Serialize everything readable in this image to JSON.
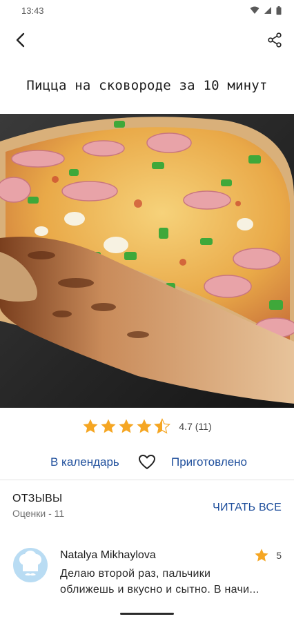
{
  "status_bar": {
    "time": "13:43"
  },
  "recipe": {
    "title": "Пицца на сковороде за 10 минут",
    "rating": {
      "stars": 4.5,
      "max": 5,
      "label": "4.7 (11)"
    }
  },
  "actions": {
    "calendar_label": "В календарь",
    "cooked_label": "Приготовлено"
  },
  "reviews": {
    "title": "ОТЗЫВЫ",
    "count_label": "Оценки - 11",
    "read_all_label": "ЧИТАТЬ ВСЕ",
    "items": [
      {
        "author": "Natalya Mikhaylova",
        "score": "5",
        "text_line1": "Делаю второй раз, пальчики",
        "text_line2": "оближешь и вкусно и сытно. В начи..."
      }
    ]
  },
  "colors": {
    "accent": "#1f4f9c",
    "star": "#f5a623",
    "avatar_bg": "#b9dcf3"
  },
  "icons": [
    "back-arrow-icon",
    "share-icon",
    "star-icon",
    "half-star-icon",
    "heart-icon",
    "chef-hat-icon",
    "wifi-icon",
    "signal-icon",
    "battery-icon"
  ]
}
